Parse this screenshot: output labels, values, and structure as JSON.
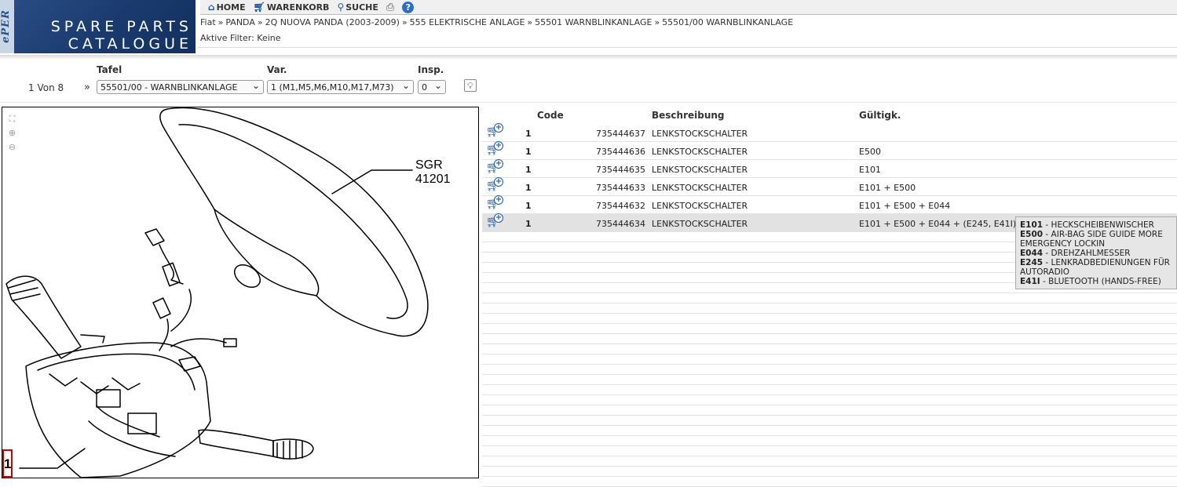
{
  "logo": {
    "brand": "ePER",
    "line1": "SPARE PARTS",
    "line2": "CATALOGUE"
  },
  "menu": {
    "home": "HOME",
    "cart": "WARENKORB",
    "search": "SUCHE"
  },
  "breadcrumb": [
    "Fiat",
    "PANDA",
    "2Q NUOVA PANDA (2003-2009)",
    "555 ELEKTRISCHE ANLAGE",
    "55501 WARNBLINKANLAGE",
    "55501/00 WARNBLINKANLAGE"
  ],
  "filter": "Aktive Filter: Keine",
  "selectors": {
    "tafel_label": "Tafel",
    "var_label": "Var.",
    "insp_label": "Insp.",
    "pager": "1 Von 8",
    "tafel_value": "55501/00 - WARNBLINKANLAGE",
    "var_value": "1 (M1,M5,M6,M10,M17,M73)",
    "insp_value": "0"
  },
  "diagram": {
    "sgr": "SGR 41201",
    "callout": "1"
  },
  "table": {
    "headers": {
      "code": "Code",
      "desc": "Beschreibung",
      "valid": "Gültigk."
    },
    "rows": [
      {
        "qty": "1",
        "code": "735444637",
        "desc": "LENKSTOCKSCHALTER",
        "valid": ""
      },
      {
        "qty": "1",
        "code": "735444636",
        "desc": "LENKSTOCKSCHALTER",
        "valid": "E500"
      },
      {
        "qty": "1",
        "code": "735444635",
        "desc": "LENKSTOCKSCHALTER",
        "valid": "E101"
      },
      {
        "qty": "1",
        "code": "735444633",
        "desc": "LENKSTOCKSCHALTER",
        "valid": "E101 + E500"
      },
      {
        "qty": "1",
        "code": "735444632",
        "desc": "LENKSTOCKSCHALTER",
        "valid": "E101 + E500 + E044"
      },
      {
        "qty": "1",
        "code": "735444634",
        "desc": "LENKSTOCKSCHALTER",
        "valid": "E101 + E500 + E044 + (E245, E41I)"
      }
    ]
  },
  "tooltip": [
    {
      "code": "E101",
      "text": " - HECKSCHEIBENWISCHER"
    },
    {
      "code": "E500",
      "text": " - AIR-BAG SIDE GUIDE MORE EMERGENCY LOCKIN"
    },
    {
      "code": "E044",
      "text": " - DREHZAHLMESSER"
    },
    {
      "code": "E245",
      "text": " - LENKRADBEDIENUNGEN FÜR AUTORADIO"
    },
    {
      "code": "E41I",
      "text": " - BLUETOOTH (HANDS-FREE)"
    }
  ]
}
